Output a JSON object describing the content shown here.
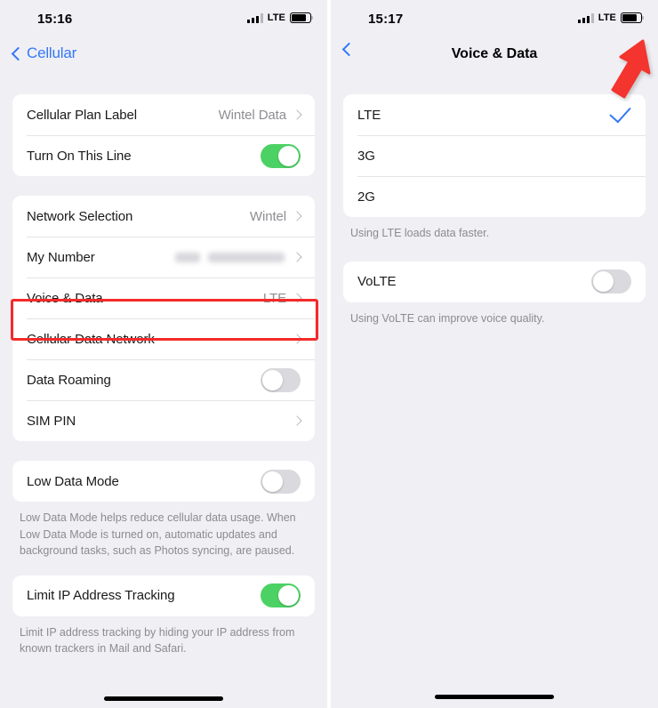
{
  "left_panel": {
    "status_bar": {
      "time": "15:16",
      "network_type": "LTE",
      "signal_icon": "signal-bars-icon",
      "battery_icon": "battery-icon"
    },
    "nav": {
      "back_label": "Cellular",
      "back_icon": "chevron-left-icon"
    },
    "group1": {
      "rows": [
        {
          "label": "Cellular Plan Label",
          "value": "Wintel Data",
          "accessory": "chevron-right-icon"
        },
        {
          "label": "Turn On This Line",
          "accessory": "toggle",
          "toggle_state": "on"
        }
      ]
    },
    "group2": {
      "rows": [
        {
          "label": "Network Selection",
          "value": "Wintel",
          "accessory": "chevron-right-icon"
        },
        {
          "label": "My Number",
          "value": "",
          "accessory": "chevron-right-icon",
          "redacted": true
        },
        {
          "label": "Voice & Data",
          "value": "LTE",
          "accessory": "chevron-right-icon",
          "highlighted": true
        },
        {
          "label": "Cellular Data Network",
          "value": "",
          "accessory": "chevron-right-icon"
        },
        {
          "label": "Data Roaming",
          "accessory": "toggle",
          "toggle_state": "off"
        },
        {
          "label": "SIM PIN",
          "value": "",
          "accessory": "chevron-right-icon"
        }
      ]
    },
    "group3": {
      "rows": [
        {
          "label": "Low Data Mode",
          "accessory": "toggle",
          "toggle_state": "off"
        }
      ],
      "footer": "Low Data Mode helps reduce cellular data usage. When Low Data Mode is turned on, automatic updates and background tasks, such as Photos syncing, are paused."
    },
    "group4": {
      "rows": [
        {
          "label": "Limit IP Address Tracking",
          "accessory": "toggle",
          "toggle_state": "on"
        }
      ],
      "footer": "Limit IP address tracking by hiding your IP address from known trackers in Mail and Safari."
    }
  },
  "right_panel": {
    "status_bar": {
      "time": "15:17",
      "network_type": "LTE",
      "signal_icon": "signal-bars-icon",
      "battery_icon": "battery-icon"
    },
    "nav": {
      "title": "Voice & Data",
      "back_icon": "chevron-left-icon"
    },
    "options": {
      "rows": [
        {
          "label": "LTE",
          "selected": true,
          "accessory": "checkmark-icon"
        },
        {
          "label": "3G",
          "selected": false
        },
        {
          "label": "2G",
          "selected": false
        }
      ],
      "footer": "Using LTE loads data faster."
    },
    "volte": {
      "rows": [
        {
          "label": "VoLTE",
          "accessory": "toggle",
          "toggle_state": "off"
        }
      ],
      "footer": "Using VoLTE can improve voice quality."
    },
    "annotation": {
      "icon": "red-arrow-icon",
      "color": "#f4342e",
      "points_to": "volte-toggle"
    }
  },
  "colors": {
    "background": "#f0eff4",
    "card": "#ffffff",
    "accent_blue": "#3478f6",
    "toggle_on_green": "#4cd264",
    "toggle_off_gray": "#d9d9de",
    "highlight_red": "#f42a2a",
    "arrow_red": "#f4342e",
    "secondary_text": "#8e8e93"
  }
}
